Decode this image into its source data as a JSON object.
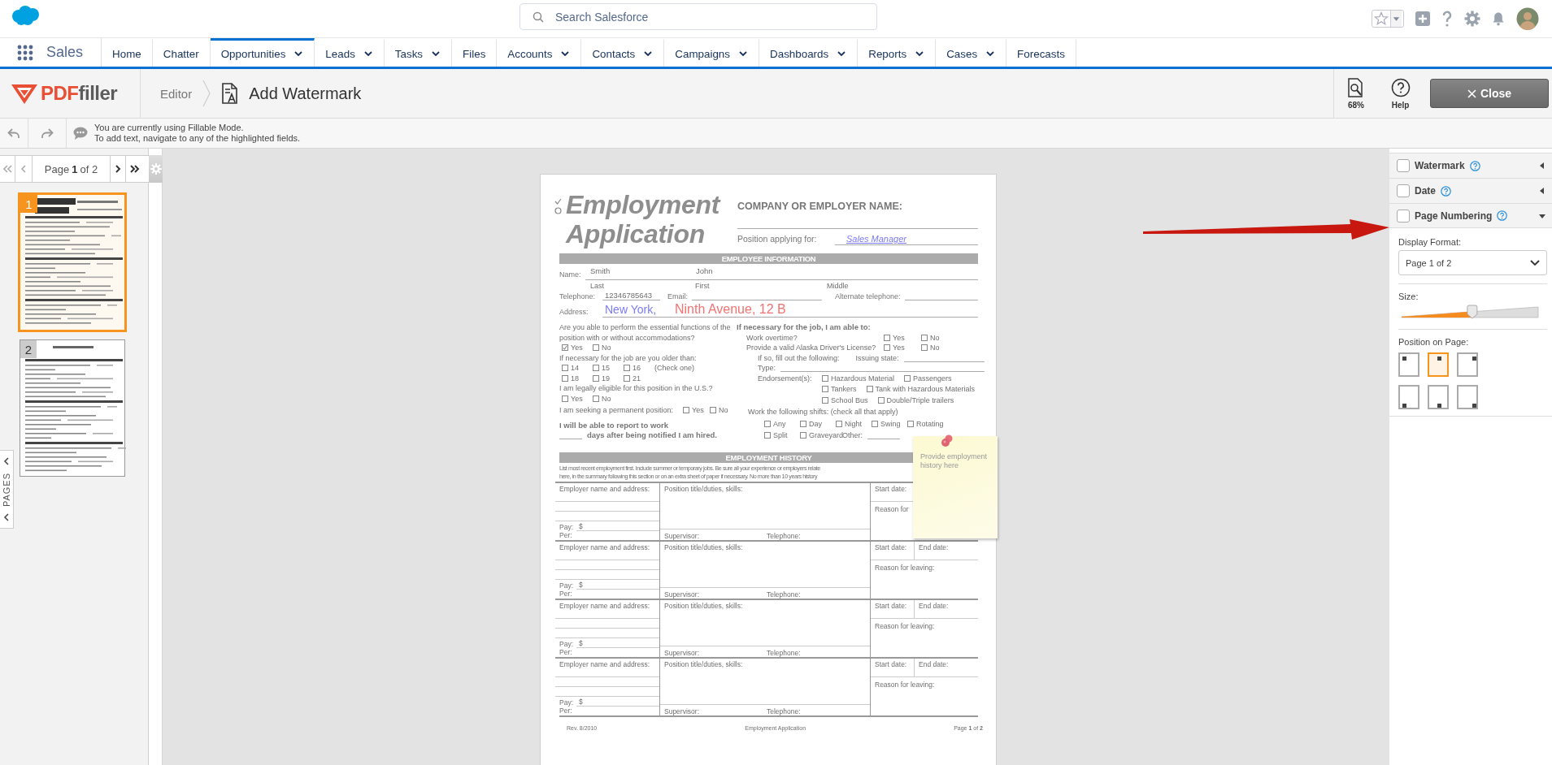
{
  "header": {
    "search_placeholder": "Search Salesforce"
  },
  "nav": {
    "app": "Sales",
    "items": [
      {
        "label": "Home",
        "menu": false,
        "selected": false
      },
      {
        "label": "Chatter",
        "menu": false,
        "selected": false
      },
      {
        "label": "Opportunities",
        "menu": true,
        "selected": true
      },
      {
        "label": "Leads",
        "menu": true,
        "selected": false
      },
      {
        "label": "Tasks",
        "menu": true,
        "selected": false
      },
      {
        "label": "Files",
        "menu": false,
        "selected": false
      },
      {
        "label": "Accounts",
        "menu": true,
        "selected": false
      },
      {
        "label": "Contacts",
        "menu": true,
        "selected": false
      },
      {
        "label": "Campaigns",
        "menu": true,
        "selected": false
      },
      {
        "label": "Dashboards",
        "menu": true,
        "selected": false
      },
      {
        "label": "Reports",
        "menu": true,
        "selected": false
      },
      {
        "label": "Cases",
        "menu": true,
        "selected": false
      },
      {
        "label": "Forecasts",
        "menu": false,
        "selected": false
      }
    ]
  },
  "editor": {
    "logo": [
      "PDF",
      "filler"
    ],
    "crumb": "Editor",
    "title": "Add Watermark",
    "zoom": "68%",
    "help": "Help",
    "close": "Close"
  },
  "notice": [
    "You are currently using Fillable Mode.",
    "To add text, navigate to any of the highlighted fields."
  ],
  "pager": {
    "label": "Page **1** of 2"
  },
  "thumbnails": [
    {
      "number": "1",
      "selected": true
    },
    {
      "number": "2",
      "selected": false
    }
  ],
  "pages_tab": "PAGES",
  "document": {
    "title": [
      "Employment",
      "Application"
    ],
    "company_label": "COMPANY OR EMPLOYER NAME:",
    "position": {
      "label": "Position applying for:",
      "value": "Sales Manager"
    },
    "section_1": "EMPLOYEE INFORMATION",
    "name": {
      "label": "Name:",
      "last": "Smith",
      "first": "John",
      "captions": [
        "Last",
        "First",
        "Middle"
      ]
    },
    "contact": {
      "telephone_label": "Telephone:",
      "telephone": "12346785643",
      "email_label": "Email:",
      "alternate_label": "Alternate telephone:"
    },
    "address": {
      "label": "Address:",
      "annotations": [
        {
          "text": "New York,",
          "color": "#7b7bf5"
        },
        {
          "text": "Ninth Avenue, 12 B",
          "color": "#f37272"
        }
      ]
    },
    "left_rows": [
      {
        "kind": "question",
        "items": [
          {
            "kind": "text",
            "text": "Are you able to perform the essential functions of the position with or without accommodations?"
          }
        ]
      },
      {
        "kind": "answers",
        "items": [
          {
            "kind": "check",
            "label": "Yes",
            "checked": true
          },
          {
            "kind": "check",
            "label": "No",
            "checked": false
          }
        ]
      },
      {
        "kind": "question",
        "items": [
          {
            "kind": "text",
            "text": "If necessary for the job are you older than:"
          }
        ]
      },
      {
        "kind": "answers",
        "items": [
          {
            "kind": "check",
            "label": "14",
            "checked": false
          },
          {
            "kind": "check",
            "label": "15",
            "checked": false
          },
          {
            "kind": "check",
            "label": "16",
            "checked": false
          },
          {
            "kind": "text",
            "text": "(Check one)"
          }
        ]
      },
      {
        "kind": "answers",
        "items": [
          {
            "kind": "check",
            "label": "18",
            "checked": false
          },
          {
            "kind": "check",
            "label": "19",
            "checked": false
          },
          {
            "kind": "check",
            "label": "21",
            "checked": false
          }
        ]
      },
      {
        "kind": "question",
        "items": [
          {
            "kind": "text",
            "text": "I am legally eligible for this position in the U.S.?"
          }
        ]
      },
      {
        "kind": "answers",
        "items": [
          {
            "kind": "check",
            "label": "Yes",
            "checked": false
          },
          {
            "kind": "check",
            "label": "No",
            "checked": false
          }
        ]
      },
      {
        "kind": "inline",
        "items": [
          {
            "kind": "text",
            "text": "I am seeking a permanent position:"
          },
          {
            "kind": "check",
            "label": "Yes",
            "checked": false
          },
          {
            "kind": "check",
            "label": "No",
            "checked": false
          }
        ]
      },
      {
        "kind": "statement",
        "items": [
          {
            "kind": "bold",
            "text": "I will be able to report to work"
          }
        ]
      },
      {
        "kind": "statement",
        "items": [
          {
            "kind": "blank"
          },
          {
            "kind": "bold",
            "text": "days after being notified I am hired."
          }
        ]
      }
    ],
    "right_rows": [
      {
        "kind": "heading",
        "items": [
          {
            "kind": "bold",
            "text": "If necessary for the job, I am able to:"
          }
        ]
      },
      {
        "kind": "yesno",
        "items": [
          {
            "kind": "text",
            "text": "Work overtime?"
          },
          {
            "kind": "check",
            "label": "Yes",
            "checked": false
          },
          {
            "kind": "check",
            "label": "No",
            "checked": false
          }
        ]
      },
      {
        "kind": "yesno",
        "items": [
          {
            "kind": "text",
            "text": "Provide a valid Alaska Driver's License?"
          },
          {
            "kind": "check",
            "label": "Yes",
            "checked": false
          },
          {
            "kind": "check",
            "label": "No",
            "checked": false
          }
        ]
      },
      {
        "kind": "detail",
        "items": [
          {
            "kind": "text",
            "text": "If so, fill out the following:"
          },
          {
            "kind": "text",
            "text": "Issuing state:"
          },
          {
            "kind": "blank"
          }
        ]
      },
      {
        "kind": "detail",
        "items": [
          {
            "kind": "text",
            "text": "Type:"
          },
          {
            "kind": "blank"
          }
        ]
      },
      {
        "kind": "endorse",
        "items": [
          {
            "kind": "text",
            "text": "Endorsement(s):"
          },
          {
            "kind": "check",
            "label": "Hazardous Material",
            "checked": false
          },
          {
            "kind": "check",
            "label": "Passengers",
            "checked": false
          }
        ]
      },
      {
        "kind": "endorse-more",
        "items": [
          {
            "kind": "check",
            "label": "Tankers",
            "checked": false
          },
          {
            "kind": "check",
            "label": "Tank with Hazardous Materials",
            "checked": false
          }
        ]
      },
      {
        "kind": "endorse-more",
        "items": [
          {
            "kind": "check",
            "label": "School Bus",
            "checked": false
          },
          {
            "kind": "check",
            "label": "Double/Triple trailers",
            "checked": false
          }
        ]
      },
      {
        "kind": "shifts-label",
        "items": [
          {
            "kind": "text",
            "text": "Work the following shifts: (check all that apply)"
          }
        ]
      },
      {
        "kind": "shifts",
        "items": [
          {
            "kind": "check",
            "label": "Any",
            "checked": false
          },
          {
            "kind": "check",
            "label": "Day",
            "checked": false
          },
          {
            "kind": "check",
            "label": "Night",
            "checked": false
          },
          {
            "kind": "check",
            "label": "Swing",
            "checked": false
          },
          {
            "kind": "check",
            "label": "Rotating",
            "checked": false
          }
        ]
      },
      {
        "kind": "shifts",
        "items": [
          {
            "kind": "check",
            "label": "Split",
            "checked": false
          },
          {
            "kind": "check",
            "label": "Graveyard",
            "checked": false
          },
          {
            "kind": "text",
            "text": "Other:"
          },
          {
            "kind": "blank"
          }
        ]
      }
    ],
    "section_2": "EMPLOYMENT HISTORY",
    "intro": [
      "List most recent employment first. Include summer or temporary jobs. Be sure all your experience or employers relate",
      "here, in the summary following this section or on an extra sheet of paper if necessary. No more than 10 years history"
    ],
    "jobs": [
      {
        "employer": "Employer name and address:",
        "position": "Position title/duties, skills:",
        "start": "Start date:",
        "reason": "Reason for",
        "pay": "Pay:",
        "currency": "$",
        "per": "Per:",
        "supervisor": "Supervisor:",
        "telephone": "Telephone:"
      },
      {
        "employer": "Employer name and address:",
        "position": "Position title/duties, skills:",
        "start": "Start date:",
        "end": "End date:",
        "reason": "Reason for leaving:",
        "pay": "Pay:",
        "currency": "$",
        "per": "Per:",
        "supervisor": "Supervisor:",
        "telephone": "Telephone:"
      },
      {
        "employer": "Employer name and address:",
        "position": "Position title/duties, skills:",
        "start": "Start date:",
        "end": "End date:",
        "reason": "Reason for leaving:",
        "pay": "Pay:",
        "currency": "$",
        "per": "Per:",
        "supervisor": "Supervisor:",
        "telephone": "Telephone:"
      },
      {
        "employer": "Employer name and address:",
        "position": "Position title/duties, skills:",
        "start": "Start date:",
        "end": "End date:",
        "reason": "Reason for leaving:",
        "pay": "Pay:",
        "currency": "$",
        "per": "Per:",
        "supervisor": "Supervisor:",
        "telephone": "Telephone:"
      }
    ],
    "footer": {
      "revision": "Rev. 8/2010",
      "title": "Employment Application",
      "page": "Page **1** of **2**"
    }
  },
  "sticky_note": {
    "text": "Provide employment history here"
  },
  "panel": {
    "sections": [
      {
        "label": "Watermark",
        "checked": false,
        "expanded": false
      },
      {
        "label": "Date",
        "checked": false,
        "expanded": false
      },
      {
        "label": "Page Numbering",
        "checked": false,
        "expanded": true
      }
    ],
    "display_format": {
      "label": "Display Format:",
      "value": "Page 1 of 2"
    },
    "size": {
      "label": "Size:",
      "level": 0.53
    },
    "position": {
      "label": "Position on Page:",
      "options": [
        {
          "kind": "topleft",
          "selected": false
        },
        {
          "kind": "topcenter",
          "selected": true
        },
        {
          "kind": "topright",
          "selected": false
        },
        {
          "kind": "bottomleft",
          "selected": false
        },
        {
          "kind": "bottomcenter",
          "selected": false
        },
        {
          "kind": "bottomright",
          "selected": false
        }
      ]
    }
  }
}
